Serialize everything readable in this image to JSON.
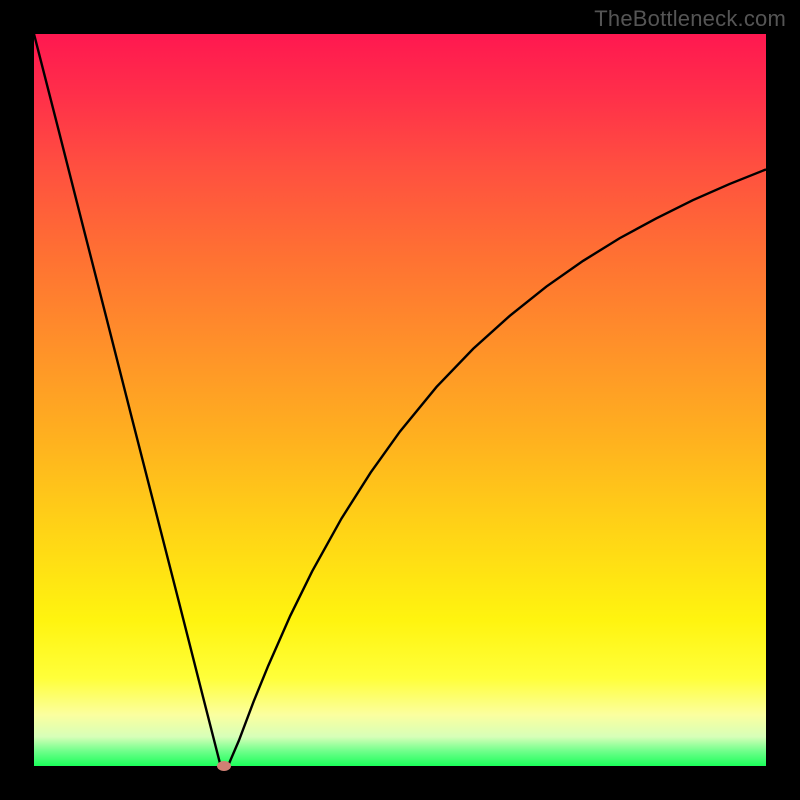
{
  "watermark": "TheBottleneck.com",
  "colors": {
    "black": "#000000",
    "curve": "#000000",
    "marker": "#d08074"
  },
  "chart_data": {
    "type": "line",
    "title": "",
    "xlabel": "",
    "ylabel": "",
    "xlim": [
      0,
      100
    ],
    "ylim": [
      0,
      100
    ],
    "grid": false,
    "legend": false,
    "description": "Bottleneck-style V-curve: steep linear descent from top-left to a minimum near x≈26, then a concave-down rise approaching ~82 at the right edge. Background is a vertical gradient from red/pink (high) through orange/yellow to green (low).",
    "series": [
      {
        "name": "curve",
        "x": [
          0,
          3.3,
          6.6,
          9.9,
          13.2,
          16.5,
          19.8,
          23.1,
          25.5,
          26.5,
          28,
          30,
          32,
          35,
          38,
          42,
          46,
          50,
          55,
          60,
          65,
          70,
          75,
          80,
          85,
          90,
          95,
          100
        ],
        "y": [
          100.0,
          87.1,
          74.1,
          61.2,
          48.2,
          35.3,
          22.4,
          9.4,
          0.0,
          0.0,
          3.5,
          8.8,
          13.7,
          20.5,
          26.6,
          33.8,
          40.1,
          45.7,
          51.8,
          57.0,
          61.5,
          65.5,
          69.0,
          72.1,
          74.8,
          77.3,
          79.5,
          81.5
        ]
      }
    ],
    "marker": {
      "x": 26,
      "y": 0
    },
    "gradient_stops": [
      {
        "pos": 0,
        "color": "#ff1850"
      },
      {
        "pos": 18,
        "color": "#ff4f40"
      },
      {
        "pos": 42,
        "color": "#ff8f2a"
      },
      {
        "pos": 68,
        "color": "#ffd416"
      },
      {
        "pos": 88,
        "color": "#ffff3a"
      },
      {
        "pos": 100,
        "color": "#1bff5a"
      }
    ]
  }
}
